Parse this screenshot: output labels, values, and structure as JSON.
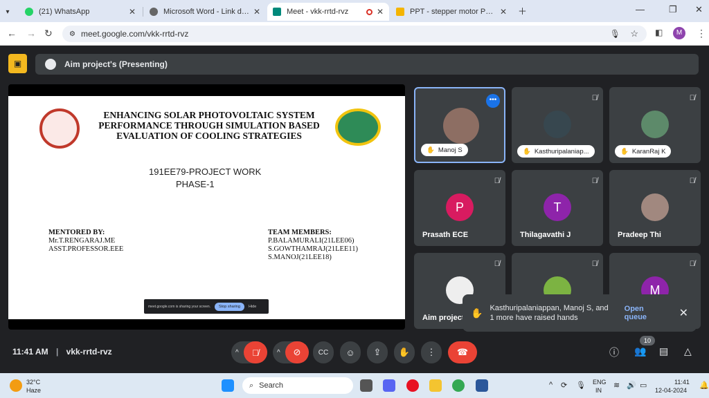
{
  "browser": {
    "tabs": [
      {
        "title": "(21) WhatsApp",
        "fav_color": "#25d366"
      },
      {
        "title": "Microsoft Word - Link details fo",
        "fav_color": "#666666"
      },
      {
        "title": "Meet - vkk-rrtd-rvz",
        "fav_color": "#00897b"
      },
      {
        "title": "PPT - stepper motor PowerPoint",
        "fav_color": "#f4b400"
      }
    ],
    "url": "meet.google.com/vkk-rrtd-rvz",
    "profile_initial": "M"
  },
  "meet": {
    "presenting_label": "Aim project's (Presenting)",
    "slide": {
      "title": "ENHANCING SOLAR PHOTOVOLTAIC SYSTEM PERFORMANCE THROUGH SIMULATION BASED EVALUATION OF COOLING STRATEGIES",
      "course": "191EE79-PROJECT WORK",
      "phase": "PHASE-1",
      "mentored_head": "MENTORED BY:",
      "mentor_1": "Mr.T.RENGARAJ.ME",
      "mentor_2": "ASST.PROFESSOR.EEE",
      "team_head": "TEAM MEMBERS:",
      "member_1": "P.BALAMURALI(21LEE06)",
      "member_2": "S.GOWTHAMRAJ(21LEE11)",
      "member_3": "S.MANOJ(21LEE18)",
      "share_text": "meet.google.com is sharing your screen.",
      "stop_label": "Stop sharing",
      "hide_label": "Hide"
    },
    "participants": [
      {
        "name": "Manoj S",
        "avatar": "",
        "color": "#8d6e63"
      },
      {
        "name": "Kasthuripalaniap...",
        "avatar": "",
        "color": "#37474f"
      },
      {
        "name": "KaranRaj K",
        "avatar": "",
        "color": "#5d8a6a"
      },
      {
        "name": "Prasath ECE",
        "avatar": "P",
        "color": "#d81b60"
      },
      {
        "name": "Thilagavathi J",
        "avatar": "T",
        "color": "#8e24aa"
      },
      {
        "name": "Pradeep Thi",
        "avatar": "",
        "color": "#a1887f"
      },
      {
        "name": "Aim project",
        "avatar": "",
        "color": "#eeeeee"
      },
      {
        "name": "",
        "avatar": "",
        "color": "#7cb342"
      },
      {
        "name": "",
        "avatar": "M",
        "color": "#8e24aa"
      }
    ],
    "toast": {
      "message": "Kasthuripalaniappan, Manoj S, and 1 more have raised hands",
      "action": "Open queue"
    },
    "time": "11:41 AM",
    "meeting_code": "vkk-rrtd-rvz",
    "people_count": "10"
  },
  "taskbar": {
    "weather_temp": "32°C",
    "weather_desc": "Haze",
    "search_placeholder": "Search",
    "lang_1": "ENG",
    "lang_2": "IN",
    "clock_time": "11:41",
    "clock_date": "12-04-2024"
  }
}
